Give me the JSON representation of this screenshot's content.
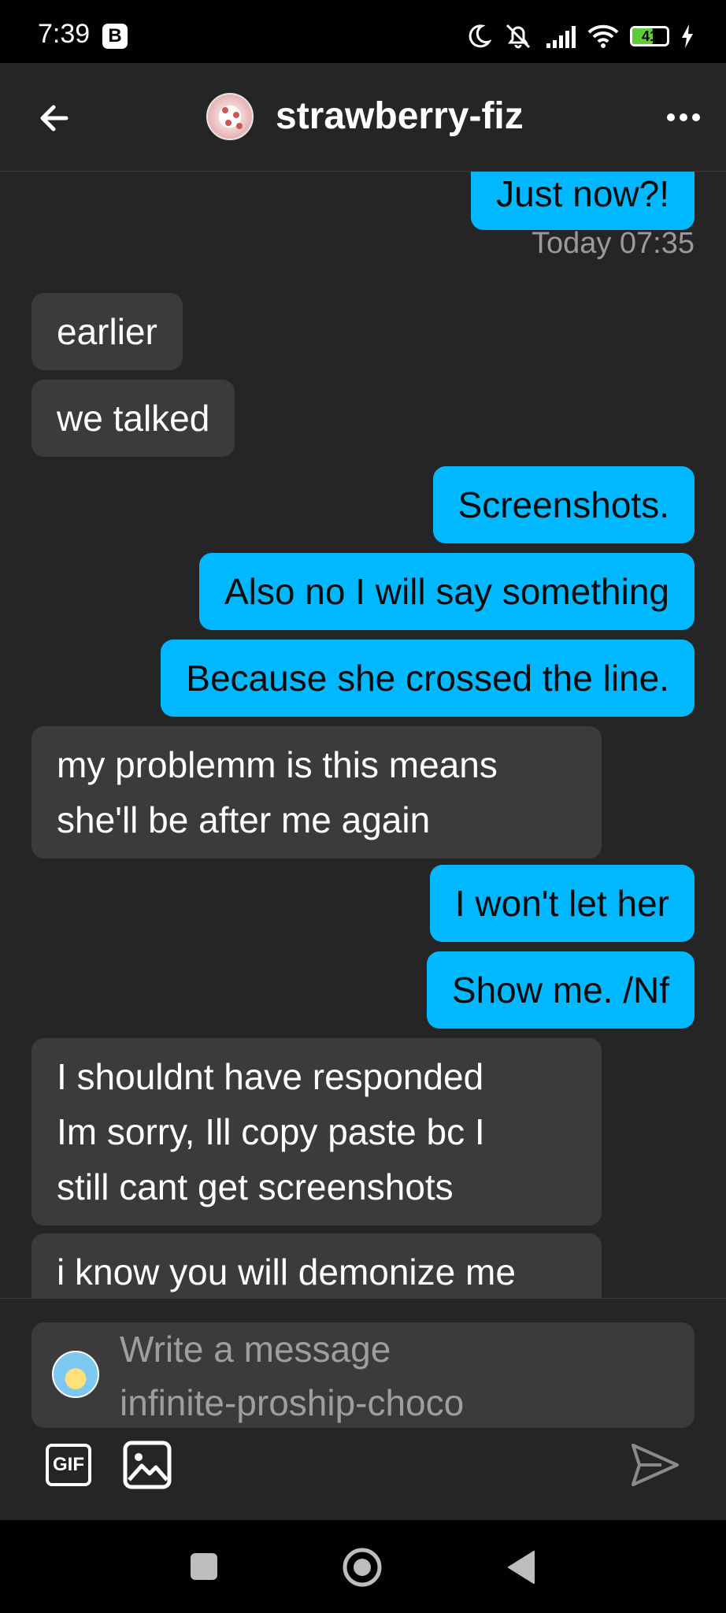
{
  "status_bar": {
    "time": "7:39",
    "badge": "B",
    "battery": "41"
  },
  "header": {
    "title": "strawberry-fiz"
  },
  "messages": [
    {
      "from": "me",
      "text": "Just now?!"
    },
    {
      "type": "timestamp",
      "text": "Today 07:35"
    },
    {
      "from": "them",
      "text": "earlier"
    },
    {
      "from": "them",
      "text": "we talked"
    },
    {
      "from": "me",
      "text": "Screenshots."
    },
    {
      "from": "me",
      "text": "Also no I will say something"
    },
    {
      "from": "me",
      "text": "Because she crossed the line."
    },
    {
      "from": "them",
      "lines": [
        "my problemm is this means",
        "she'll be after me again"
      ]
    },
    {
      "from": "me",
      "text": "I won't let her"
    },
    {
      "from": "me",
      "text": "Show me. /Nf"
    },
    {
      "from": "them",
      "lines": [
        "I shouldnt have responded",
        "Im sorry, Ill copy paste bc I",
        "still cant get screenshots"
      ]
    },
    {
      "from": "them",
      "text": "i know you will demonize me"
    }
  ],
  "composer": {
    "placeholder_line1": "Write a message",
    "placeholder_line2": "infinite-proship-choco",
    "gif_label": "GIF"
  },
  "colors": {
    "accent": "#00b8ff",
    "background": "#252525",
    "incoming_bubble": "#3b3b3b"
  }
}
